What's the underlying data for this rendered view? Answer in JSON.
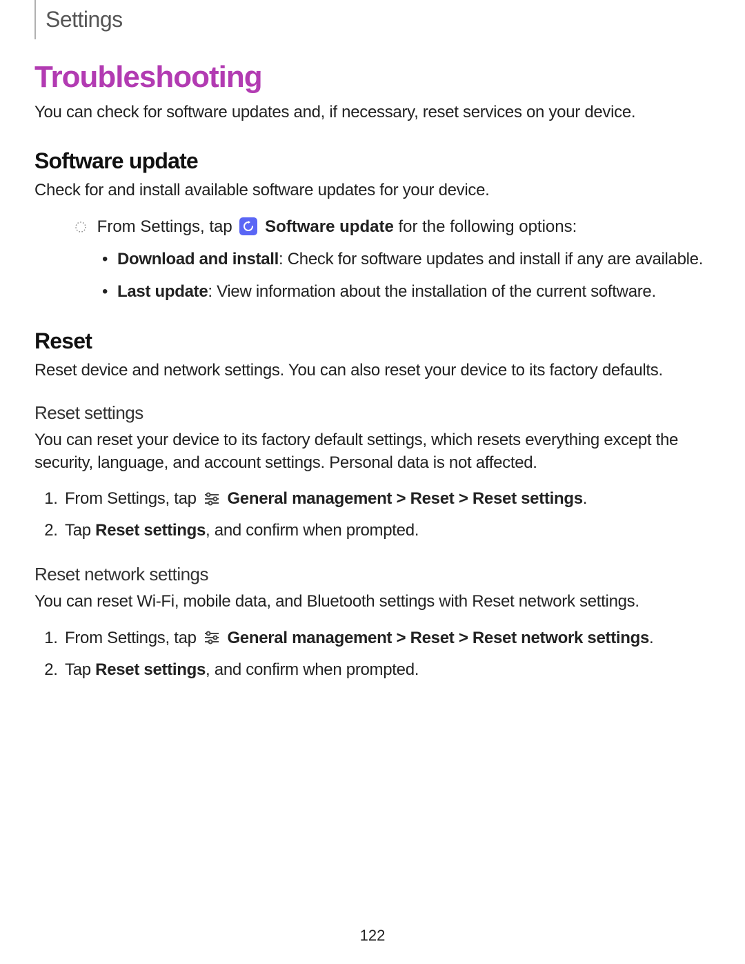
{
  "breadcrumb": "Settings",
  "title": "Troubleshooting",
  "intro": "You can check for software updates and, if necessary, reset services on your device.",
  "software_update": {
    "heading": "Software update",
    "desc": "Check for and install available software updates for your device.",
    "from_prefix": "From Settings, tap",
    "from_bold": " Software update",
    "from_suffix": " for the following options:",
    "items": [
      {
        "bold": "Download and install",
        "rest": ": Check for software updates and install if any are available."
      },
      {
        "bold": "Last update",
        "rest": ": View information about the installation of the current software."
      }
    ]
  },
  "reset": {
    "heading": "Reset",
    "desc": "Reset device and network settings. You can also reset your device to its factory defaults."
  },
  "reset_settings": {
    "heading": "Reset settings",
    "desc": "You can reset your device to its factory default settings, which resets everything except the security, language, and account settings. Personal data is not affected.",
    "step1_prefix": "From Settings, tap",
    "step1_bold": " General management > Reset > Reset settings",
    "step1_suffix": ".",
    "step2_prefix": "Tap ",
    "step2_bold": "Reset settings",
    "step2_suffix": ", and confirm when prompted."
  },
  "reset_network": {
    "heading": "Reset network settings",
    "desc": "You can reset Wi-Fi, mobile data, and Bluetooth settings with Reset network settings.",
    "step1_prefix": "From Settings, tap",
    "step1_bold": " General management > Reset > Reset network settings",
    "step1_suffix": ".",
    "step2_prefix": "Tap ",
    "step2_bold": "Reset settings",
    "step2_suffix": ", and confirm when prompted."
  },
  "page_number": "122"
}
